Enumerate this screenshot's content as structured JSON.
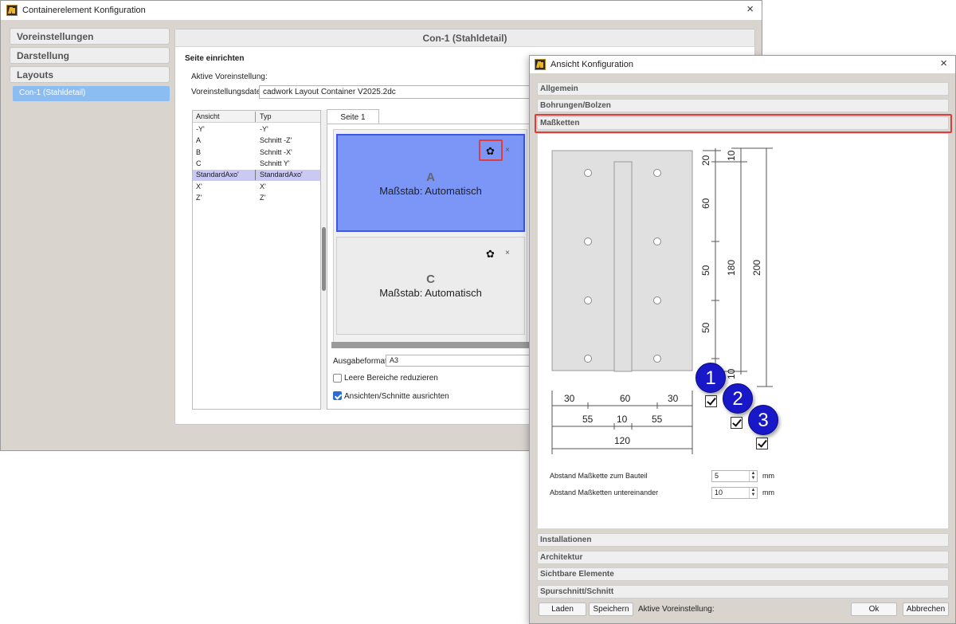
{
  "main_window": {
    "title": "Containerelement Konfiguration",
    "close": "×",
    "sidebar": {
      "items": [
        "Voreinstellungen",
        "Darstellung",
        "Layouts"
      ],
      "selected_item": "Con-1 (Stahldetail)"
    },
    "panel_title": "Con-1 (Stahldetail)",
    "section_title": "Seite einrichten",
    "active_preset_label": "Aktive Voreinstellung:",
    "preset_file_label": "Voreinstellungsdatei",
    "preset_file_value": "cadwork Layout Container V2025.2dc",
    "list": {
      "columns": [
        "Ansicht",
        "Typ"
      ],
      "rows": [
        [
          "-Y'",
          "-Y'"
        ],
        [
          "A",
          "Schnitt -Z'"
        ],
        [
          "B",
          "Schnitt -X'"
        ],
        [
          "C",
          "Schnitt Y'"
        ],
        [
          "StandardAxo'",
          "StandardAxo'"
        ],
        [
          "X'",
          "X'"
        ],
        [
          "Z'",
          "Z'"
        ]
      ],
      "selected_index": 4
    },
    "tab_label": "Seite 1",
    "views": [
      {
        "letter": "A",
        "scale": "Maßstab: Automatisch",
        "selected": true
      },
      {
        "letter": "C",
        "scale": "Maßstab: Automatisch",
        "selected": false
      }
    ],
    "gear_glyph": "✿",
    "view_close": "×",
    "output_format_label": "Ausgabeformat",
    "output_format_value": "A3",
    "reduce_empty_label": "Leere Bereiche reduzieren",
    "reduce_empty_checked": false,
    "align_views_label": "Ansichten/Schnitte ausrichten",
    "align_views_checked": true
  },
  "dialog": {
    "title": "Ansicht Konfiguration",
    "close": "×",
    "sections_top": [
      "Allgemein",
      "Bohrungen/Bolzen",
      "Maßketten"
    ],
    "sections_bottom": [
      "Installationen",
      "Architektur",
      "Sichtbare Elemente",
      "Spurschnitt/Schnitt"
    ],
    "dims_vertical_inner": [
      "20",
      "60",
      "50",
      "50",
      "10"
    ],
    "dims_vertical_mid": [
      "10",
      "180"
    ],
    "dims_vertical_outer": [
      "200"
    ],
    "dims_horizontal_row1": [
      "30",
      "60",
      "30"
    ],
    "dims_horizontal_row2": [
      "55",
      "10",
      "55"
    ],
    "dims_horizontal_row3": [
      "120"
    ],
    "badges": [
      "1",
      "2",
      "3"
    ],
    "distance_part_label": "Abstand Maßkette zum Bauteil",
    "distance_part_value": "5",
    "distance_chains_label": "Abstand Maßketten untereinander",
    "distance_chains_value": "10",
    "unit": "mm",
    "load_button": "Laden",
    "save_button": "Speichern",
    "active_preset_label": "Aktive Voreinstellung:",
    "ok_button": "Ok",
    "cancel_button": "Abbrechen"
  },
  "colors": {
    "highlight": "#e23b3b",
    "badge": "#1818c8",
    "selected_view": "#7b96f7",
    "sidebar_selected": "#8bbdf2"
  }
}
